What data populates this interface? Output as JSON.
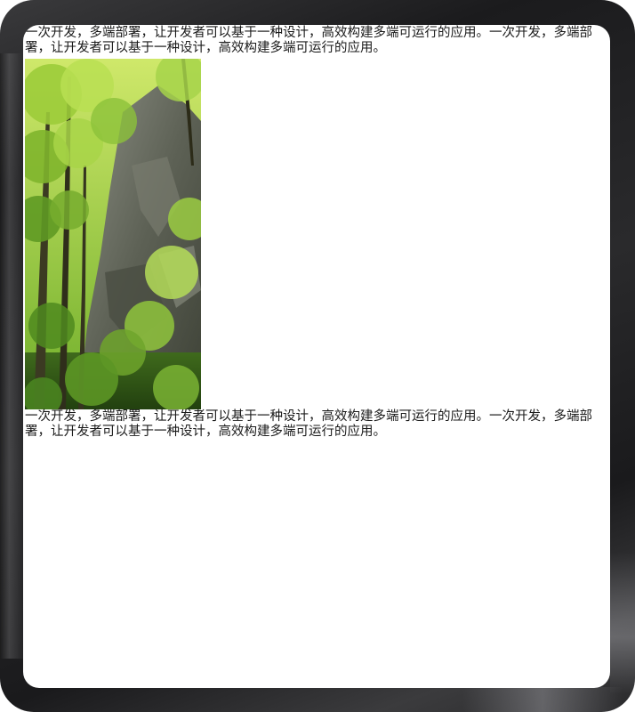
{
  "page": {
    "paragraphs": [
      "一次开发，多端部署，让开发者可以基于一种设计，高效构建多端可运行的应用。一次开发，多端部署，让开发者可以基于一种设计，高效构建多端可运行的应用。",
      "一次开发，多端部署，让开发者可以基于一种设计，高效构建多端可运行的应用。一次开发，多端部署，让开发者可以基于一种设计，高效构建多端可运行的应用。"
    ],
    "image": {
      "subject": "forest-cliff-photo"
    }
  },
  "colors": {
    "frame": "#1b1b1d",
    "screen_background": "#ffffff",
    "text": "#1a1a1a"
  }
}
